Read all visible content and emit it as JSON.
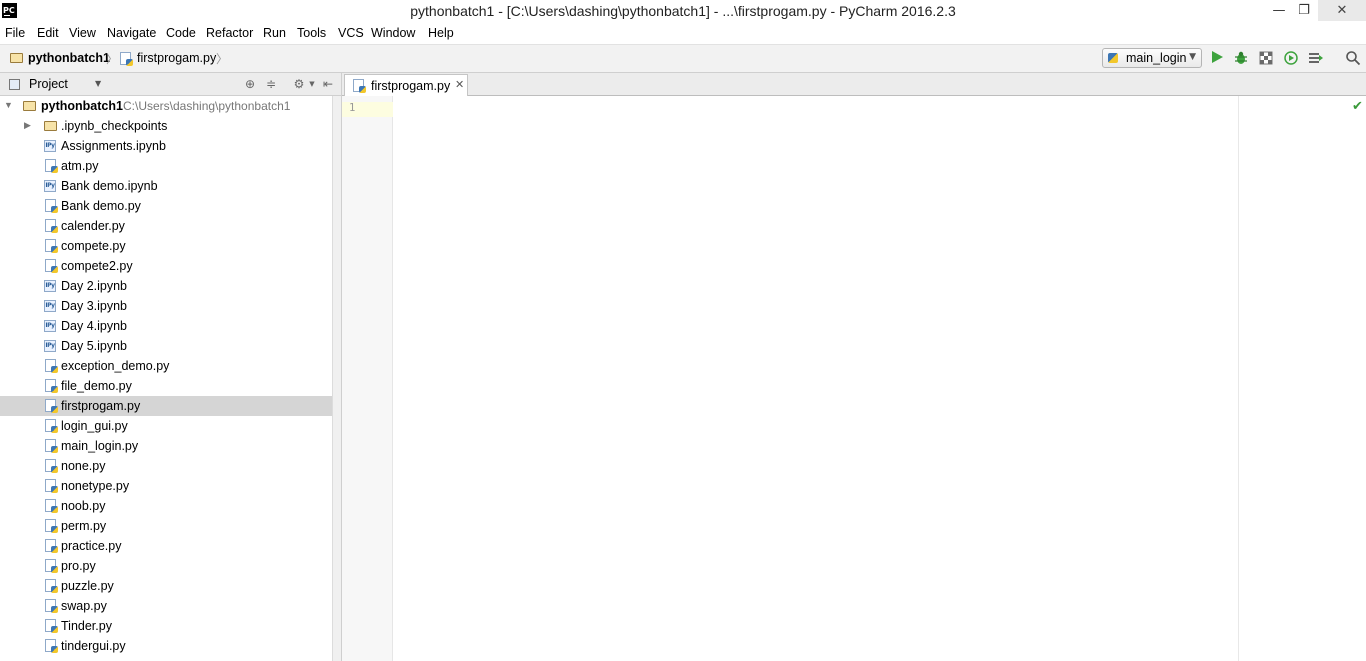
{
  "window": {
    "logo": "PC",
    "title": "pythonbatch1 - [C:\\Users\\dashing\\pythonbatch1] - ...\\firstprogam.py - PyCharm 2016.2.3",
    "minimize": "—",
    "maximize": "❐",
    "close": "✕"
  },
  "menu": [
    "File",
    "Edit",
    "View",
    "Navigate",
    "Code",
    "Refactor",
    "Run",
    "Tools",
    "VCS",
    "Window",
    "Help"
  ],
  "breadcrumb": {
    "root": "pythonbatch1",
    "file": "firstprogam.py",
    "separator": "〉"
  },
  "toolbar": {
    "run_config": "main_login",
    "run_icon": "play-icon",
    "debug_icon": "bug-icon",
    "coverage_icon": "coverage-icon",
    "profile_icon": "profile-icon",
    "concurrency_icon": "concurrency-icon",
    "search_icon": "search-icon"
  },
  "project_panel": {
    "label": "Project",
    "root_name": "pythonbatch1",
    "root_path": "C:\\Users\\dashing\\pythonbatch1",
    "items": [
      {
        "name": ".ipynb_checkpoints",
        "type": "folder"
      },
      {
        "name": "Assignments.ipynb",
        "type": "ipynb"
      },
      {
        "name": "atm.py",
        "type": "py"
      },
      {
        "name": "Bank demo.ipynb",
        "type": "ipynb"
      },
      {
        "name": "Bank demo.py",
        "type": "py"
      },
      {
        "name": "calender.py",
        "type": "py"
      },
      {
        "name": "compete.py",
        "type": "py"
      },
      {
        "name": "compete2.py",
        "type": "py"
      },
      {
        "name": "Day 2.ipynb",
        "type": "ipynb"
      },
      {
        "name": "Day 3.ipynb",
        "type": "ipynb"
      },
      {
        "name": "Day 4.ipynb",
        "type": "ipynb"
      },
      {
        "name": "Day 5.ipynb",
        "type": "ipynb"
      },
      {
        "name": "exception_demo.py",
        "type": "py"
      },
      {
        "name": "file_demo.py",
        "type": "py"
      },
      {
        "name": "firstprogam.py",
        "type": "py"
      },
      {
        "name": "login_gui.py",
        "type": "py"
      },
      {
        "name": "main_login.py",
        "type": "py"
      },
      {
        "name": "none.py",
        "type": "py"
      },
      {
        "name": "nonetype.py",
        "type": "py"
      },
      {
        "name": "noob.py",
        "type": "py"
      },
      {
        "name": "perm.py",
        "type": "py"
      },
      {
        "name": "practice.py",
        "type": "py"
      },
      {
        "name": "pro.py",
        "type": "py"
      },
      {
        "name": "puzzle.py",
        "type": "py"
      },
      {
        "name": "swap.py",
        "type": "py"
      },
      {
        "name": "Tinder.py",
        "type": "py"
      },
      {
        "name": "tindergui.py",
        "type": "py"
      }
    ],
    "selected": "firstprogam.py",
    "ipynb_badge": "IPy"
  },
  "editor": {
    "tab_label": "firstprogam.py",
    "tab_close": "✕",
    "line_numbers": [
      "1"
    ],
    "status_icon": "check-icon"
  }
}
